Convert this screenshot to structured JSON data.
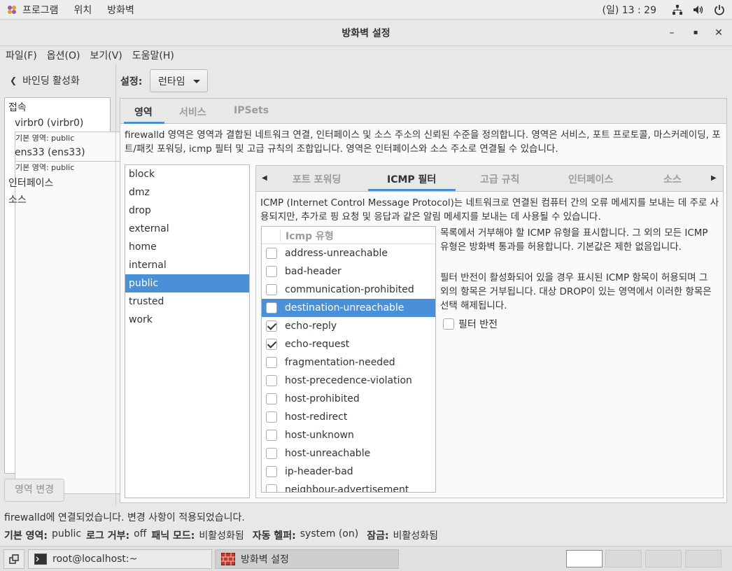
{
  "topbar": {
    "menus": [
      "프로그램",
      "위치",
      "방화벽"
    ],
    "clock": "(일) 13 : 29",
    "icons": [
      "network-icon",
      "volume-icon",
      "power-icon"
    ]
  },
  "window": {
    "title": "방화벽 설정",
    "controls": [
      "minimize-icon",
      "maximize-icon",
      "close-icon"
    ]
  },
  "menubar": [
    "파일(F)",
    "옵션(O)",
    "보기(V)",
    "도움말(H)"
  ],
  "sidebar": {
    "binding_label": "바인딩 활성화",
    "connections_header": "접속",
    "connections": [
      {
        "name": "virbr0 (virbr0)",
        "zone": "기본 영역: public"
      },
      {
        "name": "ens33 (ens33)",
        "zone": "기본 영역: public"
      }
    ],
    "interfaces_header": "인터페이스",
    "sources_header": "소스",
    "change_zone_button": "영역 변경"
  },
  "config": {
    "label": "설정:",
    "value": "런타임"
  },
  "main_tabs": [
    "영역",
    "서비스",
    "IPSets"
  ],
  "zone_description": "firewalld 영역은 영역과 결합된 네트워크 연결, 인터페이스 및 소스 주소의 신뢰된 수준을 정의합니다. 영역은 서비스, 포트 프로토콜, 마스커레이딩, 포트/패킷 포워딩, icmp 필터 및 고급 규칙의 조합입니다. 영역은 인터페이스와 소스 주소로 연결될 수 있습니다.",
  "zones": [
    "block",
    "dmz",
    "drop",
    "external",
    "home",
    "internal",
    "public",
    "trusted",
    "work"
  ],
  "selected_zone": "public",
  "sub_tabs": [
    "포트 포워딩",
    "ICMP 필터",
    "고급 규칙",
    "인터페이스",
    "소스"
  ],
  "icmp": {
    "description": "ICMP (Internet Control Message Protocol)는 네트워크로 연결된 컴퓨터 간의 오류 메세지를 보내는 데 주로 사용되지만, 추가로 핑 요청 및 응답과 같은 알림 메세지를 보내는 데 사용될 수 있습니다.",
    "column_header": "Icmp 유형",
    "types": [
      {
        "name": "address-unreachable",
        "checked": false
      },
      {
        "name": "bad-header",
        "checked": false
      },
      {
        "name": "communication-prohibited",
        "checked": false
      },
      {
        "name": "destination-unreachable",
        "checked": false,
        "selected": true
      },
      {
        "name": "echo-reply",
        "checked": true
      },
      {
        "name": "echo-request",
        "checked": true
      },
      {
        "name": "fragmentation-needed",
        "checked": false
      },
      {
        "name": "host-precedence-violation",
        "checked": false
      },
      {
        "name": "host-prohibited",
        "checked": false
      },
      {
        "name": "host-redirect",
        "checked": false
      },
      {
        "name": "host-unknown",
        "checked": false
      },
      {
        "name": "host-unreachable",
        "checked": false
      },
      {
        "name": "ip-header-bad",
        "checked": false
      },
      {
        "name": "neighbour-advertisement",
        "checked": false
      }
    ],
    "help1": "목록에서 거부해야 할 ICMP 유형을 표시합니다. 그 외의 모든 ICMP 유형은 방화벽 통과를 허용합니다. 기본값은 제한 없음입니다.",
    "help2": "필터 반전이 활성화되어 있을 경우 표시된 ICMP 항목이 허용되며 그 외의 항목은 거부됩니다. 대상 DROP이 있는 영역에서 이러한 항목은 선택 해제됩니다.",
    "invert_label": "필터 반전"
  },
  "status": {
    "message": "firewalld에 연결되었습니다. 변경 사항이 적용되었습니다.",
    "default_zone_label": "기본 영역:",
    "default_zone_value": "public",
    "log_denied_label": "로그 거부:",
    "log_denied_value": "off",
    "panic_label": "패닉 모드:",
    "panic_value": "비활성화됨",
    "helper_label": "자동 헬퍼:",
    "helper_value": "system (on)",
    "lock_label": "잠금:",
    "lock_value": "비활성화됨"
  },
  "taskbar": {
    "items": [
      "root@localhost:~",
      "방화벽 설정"
    ]
  },
  "colors": {
    "accent": "#4a90d9",
    "background": "#e8e8e7"
  }
}
